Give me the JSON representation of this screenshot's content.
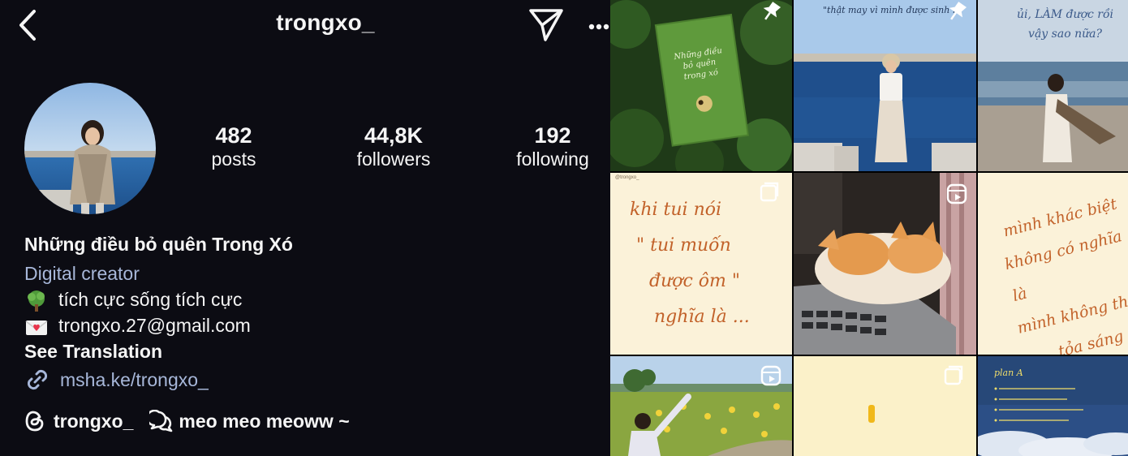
{
  "header": {
    "username": "trongxo_"
  },
  "stats": {
    "posts": {
      "value": "482",
      "label": "posts"
    },
    "followers": {
      "value": "44,8K",
      "label": "followers"
    },
    "following": {
      "value": "192",
      "label": "following"
    }
  },
  "bio": {
    "name": "Những điều bỏ quên Trong Xó",
    "category": "Digital creator",
    "line1": "tích cực sống tích cực",
    "line2": "trongxo.27@gmail.com",
    "see_translation": "See Translation",
    "link": "msha.ke/trongxo_"
  },
  "threads": {
    "handle": "trongxo_",
    "note": "meo meo meoww ~"
  },
  "icons": {
    "line1": "tree-emoji-icon",
    "line2": "love-letter-emoji-icon"
  },
  "grid": {
    "tile1_text": "Những điều bỏ quên trong xó",
    "tile2_text": "\"thật may vì mình được sinh ra",
    "tile3_text": [
      "ủi, LÀM được rồi",
      "vậy sao nữa?"
    ],
    "tile4_text": [
      "khi tui nói",
      "\" tui muốn",
      "được ôm \"",
      "nghĩa là ..."
    ],
    "tile4_watermark": "@trongxo_",
    "tile6_text": [
      "mình khác biệt",
      "không có nghĩa là",
      "mình không thể",
      "tỏa sáng"
    ],
    "tile9_title": "plan A"
  },
  "colors": {
    "background": "#0c0c13",
    "link": "#a7b7d9",
    "text": "#f5f5f5"
  }
}
